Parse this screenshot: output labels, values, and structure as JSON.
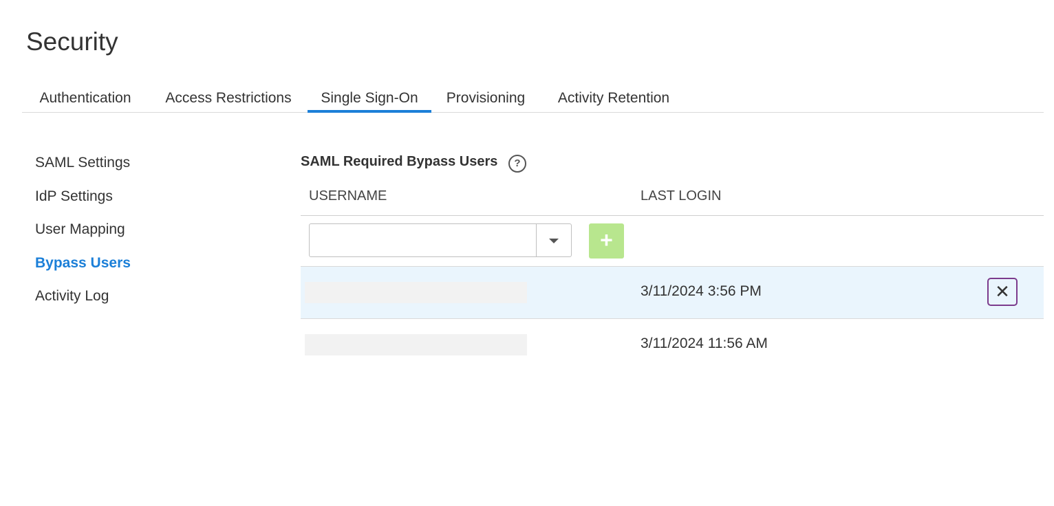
{
  "page": {
    "title": "Security"
  },
  "tabs": [
    {
      "label": "Authentication",
      "active": false
    },
    {
      "label": "Access Restrictions",
      "active": false
    },
    {
      "label": "Single Sign-On",
      "active": true
    },
    {
      "label": "Provisioning",
      "active": false
    },
    {
      "label": "Activity Retention",
      "active": false
    }
  ],
  "sidenav": {
    "items": [
      {
        "label": "SAML Settings",
        "active": false
      },
      {
        "label": "IdP Settings",
        "active": false
      },
      {
        "label": "User Mapping",
        "active": false
      },
      {
        "label": "Bypass Users",
        "active": true
      },
      {
        "label": "Activity Log",
        "active": false
      }
    ]
  },
  "section": {
    "title": "SAML Required Bypass Users",
    "help_icon": "question-circle-icon"
  },
  "table": {
    "columns": {
      "username": "USERNAME",
      "last_login": "LAST LOGIN"
    },
    "add_row": {
      "input_value": "",
      "add_label": "+"
    },
    "rows": [
      {
        "username": "",
        "last_login": "3/11/2024 3:56 PM",
        "highlighted": true,
        "remove_label": "✕"
      },
      {
        "username": "",
        "last_login": "3/11/2024 11:56 AM",
        "highlighted": false
      }
    ]
  },
  "colors": {
    "accent": "#1b7fd8",
    "add_button": "#b8e68e",
    "row_highlight": "#eaf5fd",
    "focus_outline": "#7b3a8c"
  }
}
